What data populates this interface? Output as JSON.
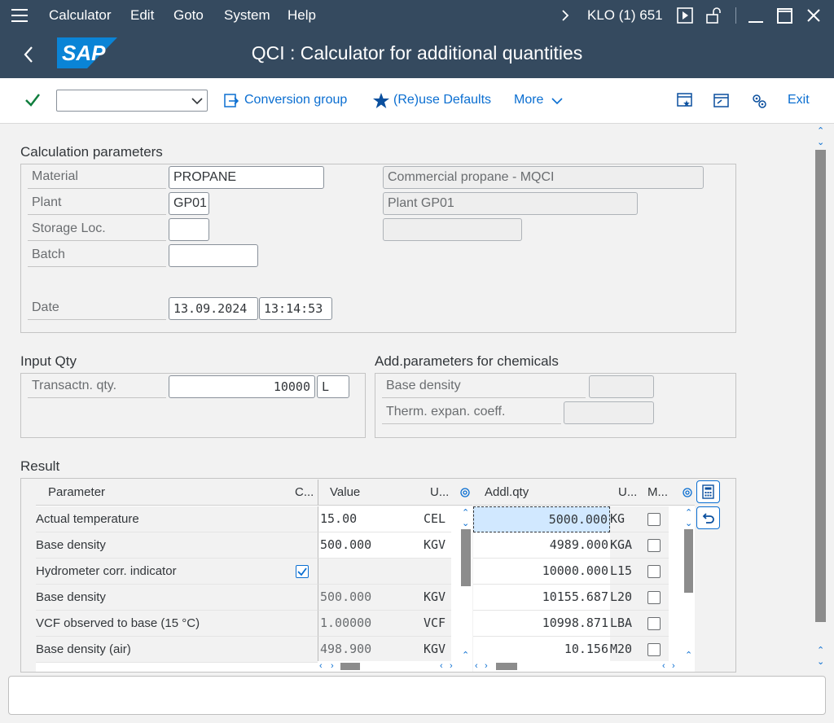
{
  "menu": {
    "items": [
      "Calculator",
      "Edit",
      "Goto",
      "System",
      "Help"
    ],
    "session": "KLO (1) 651"
  },
  "header": {
    "title": "QCI : Calculator for additional quantities",
    "logo_text": "SAP"
  },
  "toolbar": {
    "conversion_group": "Conversion group",
    "reuse_defaults": "(Re)use Defaults",
    "more": "More",
    "exit": "Exit"
  },
  "calc_params": {
    "title": "Calculation parameters",
    "material_label": "Material",
    "material_value": "PROPANE",
    "material_desc": "Commercial propane - MQCI",
    "plant_label": "Plant",
    "plant_value": "GP01",
    "plant_desc": "Plant GP01",
    "storage_label": "Storage Loc.",
    "storage_value": "",
    "storage_desc": "",
    "batch_label": "Batch",
    "batch_value": "",
    "date_label": "Date",
    "date_value": "13.09.2024",
    "time_value": "13:14:53"
  },
  "input_qty": {
    "title": "Input Qty",
    "label": "Transactn. qty.",
    "value": "10000",
    "unit": "L"
  },
  "chem_params": {
    "title": "Add.parameters for chemicals",
    "base_density_label": "Base density",
    "base_density_value": "",
    "therm_label": "Therm. expan. coeff.",
    "therm_value": ""
  },
  "result": {
    "title": "Result",
    "left_headers": {
      "parameter": "Parameter",
      "c": "C...",
      "value": "Value",
      "unit": "U..."
    },
    "right_headers": {
      "qty": "Addl.qty",
      "unit": "U...",
      "m": "M..."
    },
    "left_rows": [
      {
        "parameter": "Actual temperature",
        "checked": false,
        "value": "15.00",
        "unit": "CEL"
      },
      {
        "parameter": "Base density",
        "checked": false,
        "value": "500.000",
        "unit": "KGV"
      },
      {
        "parameter": "Hydrometer corr. indicator",
        "checked": true,
        "value": "",
        "unit": ""
      },
      {
        "parameter": "Base density",
        "checked": false,
        "value": "500.000",
        "unit": "KGV"
      },
      {
        "parameter": "VCF observed to base (15 °C)",
        "checked": false,
        "value": "1.00000",
        "unit": "VCF"
      },
      {
        "parameter": "Base density (air)",
        "checked": false,
        "value": "498.900",
        "unit": "KGV"
      }
    ],
    "right_rows": [
      {
        "qty": "5000.000",
        "unit": "KG",
        "m": false
      },
      {
        "qty": "4989.000",
        "unit": "KGA",
        "m": false
      },
      {
        "qty": "10000.000",
        "unit": "L15",
        "m": false
      },
      {
        "qty": "10155.687",
        "unit": "L20",
        "m": false
      },
      {
        "qty": "10998.871",
        "unit": "LBA",
        "m": false
      },
      {
        "qty": "10.156",
        "unit": "M20",
        "m": false
      }
    ]
  },
  "colors": {
    "shell": "#354a5f",
    "accent": "#0a6ed1",
    "check": "#107e3e"
  }
}
